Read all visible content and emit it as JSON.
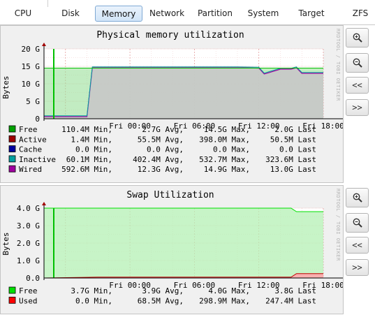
{
  "tabs": [
    {
      "label": "CPU",
      "active": false
    },
    {
      "label": "Disk",
      "active": false
    },
    {
      "label": "Memory",
      "active": true
    },
    {
      "label": "Network",
      "active": false
    },
    {
      "label": "Partition",
      "active": false
    },
    {
      "label": "System",
      "active": false
    },
    {
      "label": "Target",
      "active": false
    },
    {
      "label": "ZFS",
      "active": false
    }
  ],
  "buttons": {
    "zoom_in_icon": "magnifier-plus-icon",
    "zoom_out_icon": "magnifier-minus-icon",
    "back_label": "<<",
    "forward_label": ">>"
  },
  "watermark": "RRDTOOL / TOBI OETIKER",
  "chart_data": [
    {
      "type": "area",
      "title": "Physical memory utilization",
      "ylabel": "Bytes",
      "ylim": [
        0,
        20
      ],
      "y_ticks": [
        "20 G",
        "15 G",
        "10 G",
        "5 G",
        "0"
      ],
      "x_ticks": [
        "Fri 00:00",
        "Fri 06:00",
        "Fri 12:00",
        "Fri 18:00"
      ],
      "grid": true,
      "x": [
        "Thu 16:00",
        "Thu 17:30",
        "Thu 18:00",
        "Thu 20:00",
        "Thu 20:30",
        "Fri 00:00",
        "Fri 06:00",
        "Fri 10:00",
        "Fri 12:00",
        "Fri 12:30",
        "Fri 14:00",
        "Fri 15:00",
        "Fri 15:30",
        "Fri 16:00",
        "Fri 16:30",
        "Fri 18:00"
      ],
      "series": [
        {
          "name": "Free",
          "color": "#00c000",
          "values": [
            14.5,
            14.5,
            14.5,
            14.5,
            14.5,
            14.5,
            14.5,
            14.5,
            14.5,
            14.5,
            14.5,
            14.5,
            14.5,
            14.5,
            14.5,
            14.5
          ]
        },
        {
          "name": "Wired",
          "color": "#a000a0",
          "values": [
            0.6,
            0.6,
            0.6,
            0.6,
            14.6,
            14.6,
            14.6,
            14.6,
            14.5,
            12.8,
            14.2,
            14.2,
            14.6,
            13.0,
            13.0,
            13.0
          ]
        },
        {
          "name": "Inactive",
          "color": "#00a0a0",
          "values": [
            0.1,
            0.1,
            0.1,
            0.1,
            0.4,
            0.4,
            0.4,
            0.4,
            0.4,
            0.4,
            0.4,
            0.4,
            0.4,
            0.3,
            0.3,
            0.3
          ]
        }
      ],
      "legend": [
        {
          "name": "Free",
          "color": "#00a000",
          "min": "110.4M Min,",
          "avg": "2.7G Avg,",
          "max": "14.5G Max,",
          "last": "2.0G Last"
        },
        {
          "name": "Active",
          "color": "#a00000",
          "min": "1.4M Min,",
          "avg": "55.5M Avg,",
          "max": "398.0M Max,",
          "last": "50.5M Last"
        },
        {
          "name": "Cache",
          "color": "#0000a0",
          "min": "0.0 Min,",
          "avg": "0.0 Avg,",
          "max": "0.0 Max,",
          "last": "0.0 Last"
        },
        {
          "name": "Inactive",
          "color": "#00a0a0",
          "min": "60.1M Min,",
          "avg": "402.4M Avg,",
          "max": "532.7M Max,",
          "last": "323.6M Last"
        },
        {
          "name": "Wired",
          "color": "#a000a0",
          "min": "592.6M Min,",
          "avg": "12.3G Avg,",
          "max": "14.9G Max,",
          "last": "13.0G Last"
        }
      ]
    },
    {
      "type": "area",
      "title": "Swap Utilization",
      "ylabel": "Bytes",
      "ylim": [
        0,
        4.0
      ],
      "y_ticks": [
        "4.0 G",
        "3.0 G",
        "2.0 G",
        "1.0 G",
        "0.0"
      ],
      "x_ticks": [
        "Fri 00:00",
        "Fri 06:00",
        "Fri 12:00",
        "Fri 18:00"
      ],
      "grid": true,
      "x": [
        "Thu 16:00",
        "Thu 21:00",
        "Fri 15:00",
        "Fri 15:30",
        "Fri 18:00"
      ],
      "series": [
        {
          "name": "Free",
          "color": "#00e000",
          "values": [
            4.0,
            4.0,
            4.0,
            3.8,
            3.8
          ]
        },
        {
          "name": "Used",
          "color": "#ff0000",
          "values": [
            0.0,
            0.05,
            0.05,
            0.25,
            0.25
          ]
        }
      ],
      "legend": [
        {
          "name": "Free",
          "color": "#00e000",
          "min": "3.7G Min,",
          "avg": "3.9G Avg,",
          "max": "4.0G Max,",
          "last": "3.8G Last"
        },
        {
          "name": "Used",
          "color": "#ff0000",
          "min": "0.0 Min,",
          "avg": "68.5M Avg,",
          "max": "298.9M Max,",
          "last": "247.4M Last"
        }
      ]
    }
  ]
}
